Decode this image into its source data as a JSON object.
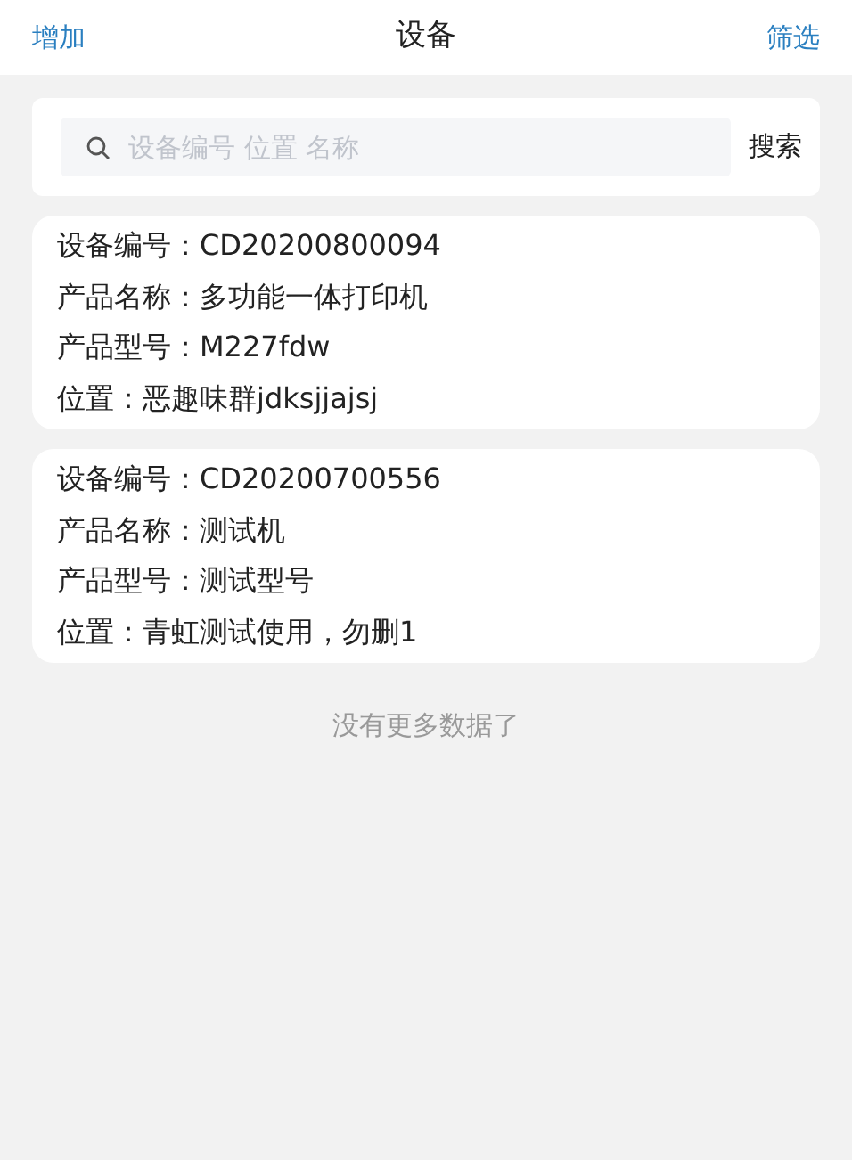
{
  "header": {
    "left_action": "增加",
    "title": "设备",
    "right_action": "筛选"
  },
  "search": {
    "placeholder": "设备编号 位置 名称",
    "button": "搜索"
  },
  "devices": [
    {
      "lines": [
        "设备编号：CD20200800094",
        "产品名称：多功能一体打印机",
        "产品型号：M227fdw",
        "位置：恶趣味群jdksjjajsj"
      ]
    },
    {
      "lines": [
        "设备编号：CD20200700556",
        "产品名称：测试机",
        "产品型号：测试型号",
        "位置：青虹测试使用，勿删1"
      ]
    }
  ],
  "footer": "没有更多数据了"
}
